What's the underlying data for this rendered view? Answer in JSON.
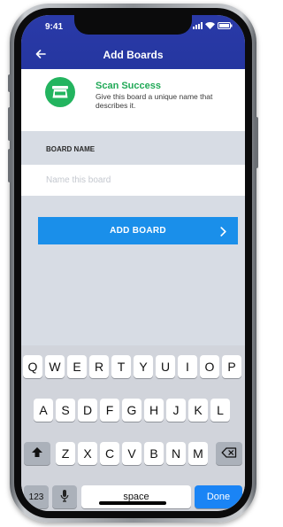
{
  "status_bar": {
    "time": "9:41"
  },
  "header": {
    "title": "Add Boards",
    "back_icon": "arrow-left-icon"
  },
  "success": {
    "title": "Scan Success",
    "message": "Give this board a unique name that describes it.",
    "icon": "scanner-icon",
    "accent": "#23b45f"
  },
  "board_name": {
    "label": "BOARD NAME",
    "value": "",
    "placeholder": "Name this board"
  },
  "add_button": {
    "label": "ADD BOARD",
    "icon": "chevron-right-icon",
    "color": "#1a8fea"
  },
  "keyboard": {
    "row1": [
      "Q",
      "W",
      "E",
      "R",
      "T",
      "Y",
      "U",
      "I",
      "O",
      "P"
    ],
    "row2": [
      "A",
      "S",
      "D",
      "F",
      "G",
      "H",
      "J",
      "K",
      "L"
    ],
    "row3": [
      "Z",
      "X",
      "C",
      "V",
      "B",
      "N",
      "M"
    ],
    "numbers_key": "123",
    "space_key": "space",
    "done_key": "Done",
    "done_color": "#1a84f5"
  },
  "colors": {
    "header": "#2536a0",
    "background": "#d7dce4"
  }
}
